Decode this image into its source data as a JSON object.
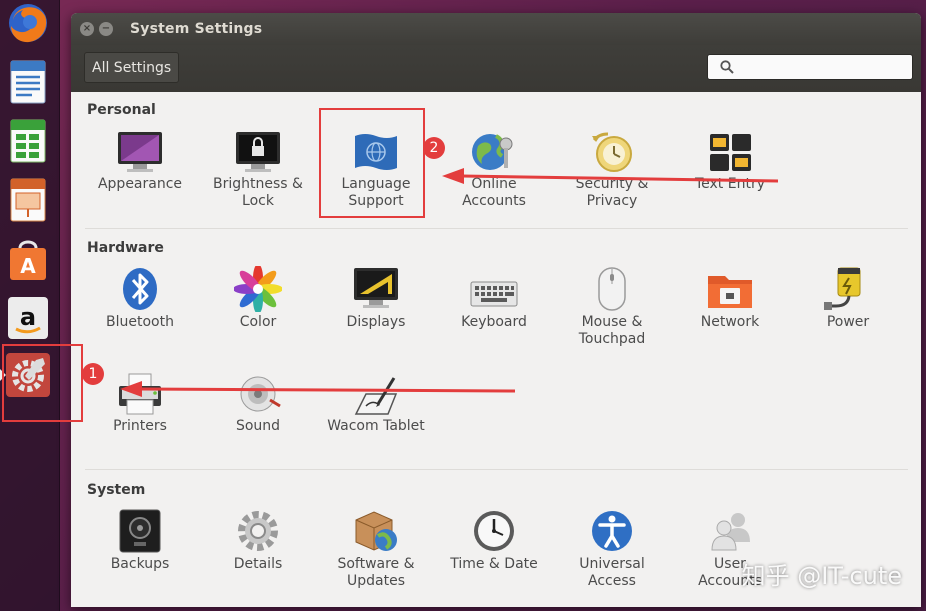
{
  "launcher": {
    "items": [
      {
        "name": "firefox-icon"
      },
      {
        "name": "libreoffice-writer-icon"
      },
      {
        "name": "libreoffice-calc-icon"
      },
      {
        "name": "libreoffice-impress-icon"
      },
      {
        "name": "software-center-icon"
      },
      {
        "name": "amazon-icon"
      },
      {
        "name": "system-settings-icon",
        "active": true
      }
    ]
  },
  "window": {
    "title": "System Settings",
    "all_settings_label": "All Settings",
    "search_placeholder": ""
  },
  "sections": [
    {
      "title": "Personal",
      "items": [
        {
          "label": "Appearance",
          "icon": "appearance-icon"
        },
        {
          "label": "Brightness &\nLock",
          "icon": "brightness-lock-icon"
        },
        {
          "label": "Language\nSupport",
          "icon": "language-support-icon"
        },
        {
          "label": "Online\nAccounts",
          "icon": "online-accounts-icon"
        },
        {
          "label": "Security &\nPrivacy",
          "icon": "security-privacy-icon"
        },
        {
          "label": "Text Entry",
          "icon": "text-entry-icon"
        }
      ]
    },
    {
      "title": "Hardware",
      "items": [
        {
          "label": "Bluetooth",
          "icon": "bluetooth-icon"
        },
        {
          "label": "Color",
          "icon": "color-icon"
        },
        {
          "label": "Displays",
          "icon": "displays-icon"
        },
        {
          "label": "Keyboard",
          "icon": "keyboard-icon"
        },
        {
          "label": "Mouse &\nTouchpad",
          "icon": "mouse-touchpad-icon"
        },
        {
          "label": "Network",
          "icon": "network-icon"
        },
        {
          "label": "Power",
          "icon": "power-icon"
        },
        {
          "label": "Printers",
          "icon": "printers-icon"
        },
        {
          "label": "Sound",
          "icon": "sound-icon"
        },
        {
          "label": "Wacom Tablet",
          "icon": "wacom-tablet-icon"
        }
      ]
    },
    {
      "title": "System",
      "items": [
        {
          "label": "Backups",
          "icon": "backups-icon"
        },
        {
          "label": "Details",
          "icon": "details-icon"
        },
        {
          "label": "Software &\nUpdates",
          "icon": "software-updates-icon"
        },
        {
          "label": "Time & Date",
          "icon": "time-date-icon"
        },
        {
          "label": "Universal\nAccess",
          "icon": "universal-access-icon"
        },
        {
          "label": "User\nAccounts",
          "icon": "user-accounts-icon"
        }
      ]
    }
  ],
  "annotations": {
    "badge_1": "1",
    "badge_2": "2",
    "color": "#e33d3d"
  },
  "watermark": "知乎 @IT-cute"
}
